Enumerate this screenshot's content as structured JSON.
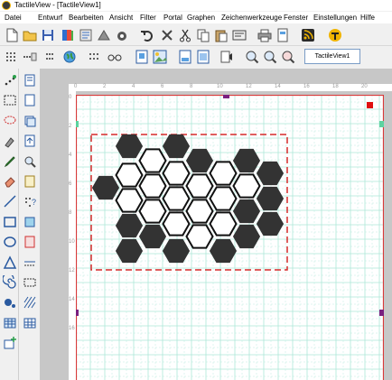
{
  "window": {
    "title": "TactileView - [TactileView1]"
  },
  "menu": [
    "Datei",
    "Entwurf",
    "Bearbeiten",
    "Ansicht",
    "Filter",
    "Portal",
    "Graphen",
    "Zeichenwerkzeuge",
    "Fenster",
    "Einstellungen",
    "Hilfe"
  ],
  "toolbar_top": [
    "new-document-icon",
    "open-folder-icon",
    "save-icon",
    "book-icon",
    "scan-icon",
    "library-icon",
    "camera-icon",
    "undo-icon",
    "delete-x-icon",
    "cut-icon",
    "copy-icon",
    "paste-icon",
    "capture-icon",
    "print-icon",
    "print-preview-icon",
    "rss-feed-icon",
    "portal-icon"
  ],
  "toolbar_second": [
    "dotted-pattern-icon",
    "globe-icon",
    "dotted-grid-icon",
    "glasses-icon",
    "frame-page-icon",
    "image-icon",
    "fit-page-icon",
    "page-view-icon",
    "audio-label-icon",
    "zoom-in-icon",
    "zoom-out-icon",
    "zoom-fit-icon"
  ],
  "document_tab": {
    "label": "TactileView1"
  },
  "left_tools": [
    "dot-line-icon",
    "document-page-icon",
    "rect-select-icon",
    "page-icon",
    "lasso-icon",
    "layer-icon",
    "paint-tool-icon",
    "page-up-icon",
    "pen-icon",
    "zoom-tool-icon",
    "eraser-icon",
    "doc-icon",
    "line-icon",
    "braille-text-icon",
    "rectangle-icon",
    "fill-icon",
    "ellipse-icon",
    "frame-icon",
    "triangle-icon",
    "dotted-line-icon",
    "spiral-icon",
    "dash-box-icon",
    "bullet-dots-icon",
    "hatch-pattern-icon",
    "table-icon",
    "grid-table-icon",
    "add-table-icon"
  ],
  "ruler": {
    "h_labels": [
      "0",
      "2",
      "4",
      "6",
      "8",
      "10",
      "12",
      "14",
      "16",
      "18",
      "20"
    ],
    "v_labels": [
      "0",
      "2",
      "4",
      "6",
      "8",
      "10",
      "12",
      "14",
      "16"
    ]
  },
  "colors": {
    "accent_tab": "#7a9cc6",
    "grid_line": "#aee8d8",
    "page_border": "#d83a3a",
    "selection_dash": "#d62a2a",
    "handle_purple": "#7a2080",
    "handle_green": "#5ed3a0",
    "hex_filled": "#333333"
  }
}
